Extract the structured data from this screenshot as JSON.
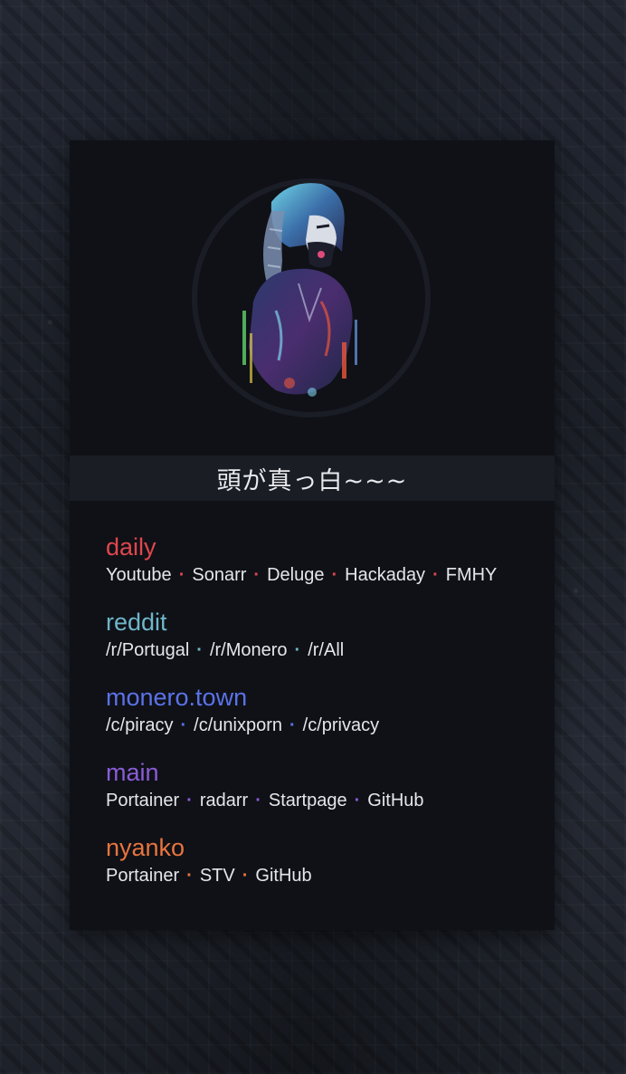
{
  "title": "頭が真っ白~~~",
  "avatar_icon": "anime-girl-portrait-icon",
  "groups": [
    {
      "name": "daily",
      "color": "#e0474c",
      "links": [
        "Youtube",
        "Sonarr",
        "Deluge",
        "Hackaday",
        "FMHY"
      ]
    },
    {
      "name": "reddit",
      "color": "#6fb6c9",
      "links": [
        "/r/Portugal",
        "/r/Monero",
        "/r/All"
      ]
    },
    {
      "name": "monero.town",
      "color": "#5b72e8",
      "links": [
        "/c/piracy",
        "/c/unixporn",
        "/c/privacy"
      ]
    },
    {
      "name": "main",
      "color": "#8a5cd6",
      "links": [
        "Portainer",
        "radarr",
        "Startpage",
        "GitHub"
      ]
    },
    {
      "name": "nyanko",
      "color": "#e8743e",
      "links": [
        "Portainer",
        "STV",
        "GitHub"
      ]
    }
  ]
}
